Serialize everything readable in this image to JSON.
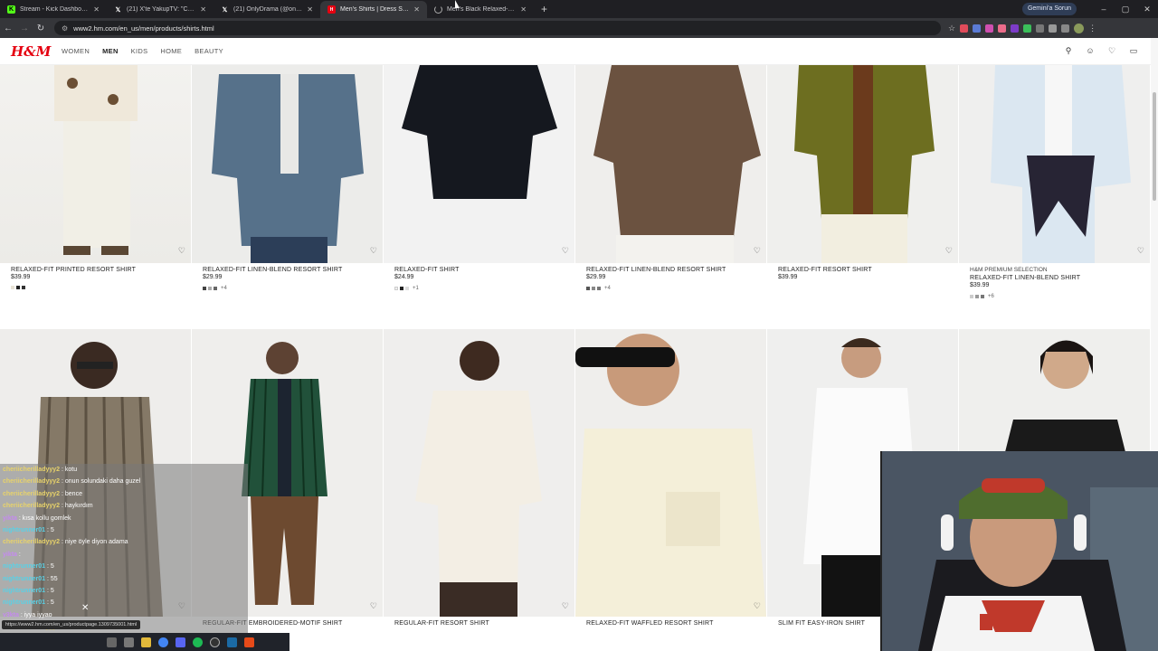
{
  "browser": {
    "tabs": [
      {
        "title": "Stream - Kick Dashboard",
        "favicon": "kick-icon"
      },
      {
        "title": "(21) X'te YakupTV: \"Cago kardo",
        "favicon": "x-icon"
      },
      {
        "title": "(21) OnlyDrama (@onlydrama)",
        "favicon": "x-icon"
      },
      {
        "title": "Men's Shirts | Dress Shirts, Polo",
        "favicon": "hm-icon"
      },
      {
        "title": "Men's Black Relaxed-Fit Shirt |",
        "favicon": "loading-icon"
      }
    ],
    "active_tab": 3,
    "gemini_label": "Gemini'a Sorun",
    "url": "www2.hm.com/en_us/men/products/shirts.html"
  },
  "site": {
    "logo": "H&M",
    "nav": [
      "WOMEN",
      "MEN",
      "KIDS",
      "HOME",
      "BEAUTY"
    ],
    "active_nav": "MEN"
  },
  "products_row1": [
    {
      "name": "RELAXED-FIT PRINTED RESORT SHIRT",
      "price": "$39.99",
      "swatch_more": ""
    },
    {
      "name": "RELAXED-FIT LINEN-BLEND RESORT SHIRT",
      "price": "$29.99",
      "swatch_more": "+4"
    },
    {
      "name": "RELAXED-FIT SHIRT",
      "price": "$24.99",
      "swatch_more": "+1"
    },
    {
      "name": "RELAXED-FIT LINEN-BLEND RESORT SHIRT",
      "price": "$29.99",
      "swatch_more": "+4"
    },
    {
      "name": "RELAXED-FIT RESORT SHIRT",
      "price": "$39.99",
      "swatch_more": ""
    },
    {
      "series": "H&M PREMIUM SELECTION",
      "name": "RELAXED-FIT LINEN-BLEND SHIRT",
      "price": "$39.99",
      "swatch_more": "+6"
    }
  ],
  "products_row2": [
    {
      "name": "REGULAR-FIT EMBROIDERED-MOTIF SHIRT"
    },
    {
      "name": "REGULAR-FIT RESORT SHIRT"
    },
    {
      "name": "RELAXED-FIT WAFFLED RESORT SHIRT"
    },
    {
      "name": "SLIM FIT EASY-IRON SHIRT"
    }
  ],
  "chat": [
    {
      "user": "cheriicherilladyyy2",
      "msg": ": kotu",
      "color": "#e8d36a"
    },
    {
      "user": "cheriicherilladyyy2",
      "msg": ": onun solundaki daha guzel",
      "color": "#e8d36a"
    },
    {
      "user": "cheriicherilladyyy2",
      "msg": ": bence",
      "color": "#e8d36a"
    },
    {
      "user": "cheriicherilladyyy2",
      "msg": ": haykırdım",
      "color": "#e8d36a"
    },
    {
      "user": "yikta",
      "msg": ": kısa kollu gomlek",
      "color": "#c58af0"
    },
    {
      "user": "nightrunner01",
      "msg": ": 5",
      "color": "#5ad1e6"
    },
    {
      "user": "cheriicherilladyyy2",
      "msg": ": niye öyle diyon adama",
      "color": "#e8d36a"
    },
    {
      "user": "yikta",
      "msg": ":",
      "color": "#c58af0"
    },
    {
      "user": "nightrunner01",
      "msg": ": 5",
      "color": "#5ad1e6"
    },
    {
      "user": "nightrunner01",
      "msg": ": 55",
      "color": "#5ad1e6"
    },
    {
      "user": "nightrunner01",
      "msg": ": 5",
      "color": "#5ad1e6"
    },
    {
      "user": "nightrunner01",
      "msg": ": 5",
      "color": "#5ad1e6"
    },
    {
      "user": "v3kta",
      "msg": ": iyya iyyao",
      "color": "#c58af0"
    },
    {
      "user": "cheriicherilladyyy2",
      "msg": ": buda kısa mı ne",
      "color": "#e8d36a"
    }
  ],
  "status_url": "https://www2.hm.com/en_us/productpage.1309735001.html"
}
